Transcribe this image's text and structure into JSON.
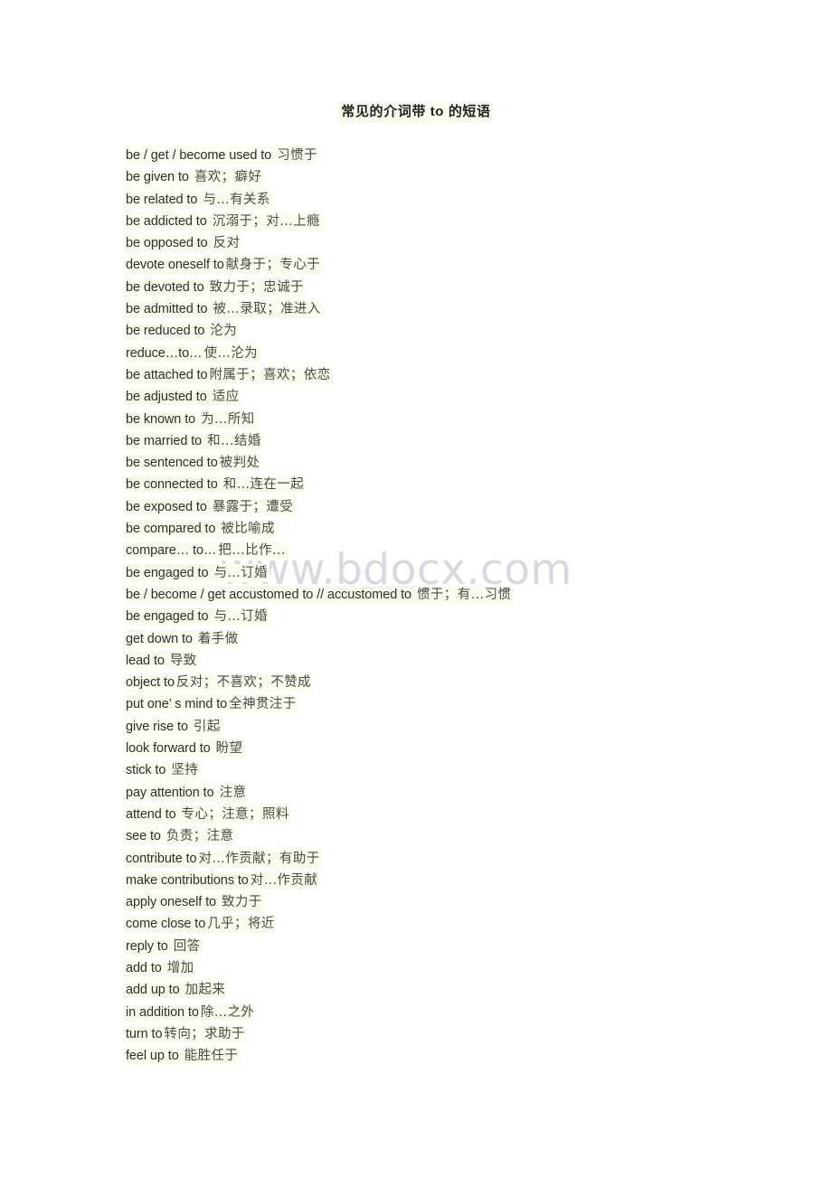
{
  "document": {
    "title": "常见的介词带 to 的短语",
    "watermark": "www.bdocx.com",
    "colors": {
      "page_background": "#ffffff",
      "text_highlight": "#fbfbee",
      "english_text": "#2e2e2e",
      "chinese_text": "#4a4a48",
      "watermark_text": "#d8d8e2"
    }
  },
  "phrases": [
    {
      "en": "be / get / become used to",
      "zh": "习惯于",
      "gap": "wide"
    },
    {
      "en": "be given to",
      "zh": "喜欢；癖好",
      "gap": "wide"
    },
    {
      "en": "be related to",
      "zh": "与…有关系",
      "gap": "wide"
    },
    {
      "en": "be addicted to",
      "zh": "沉溺于；对…上瘾",
      "gap": "wide"
    },
    {
      "en": "be opposed to",
      "zh": "反对",
      "gap": "wide"
    },
    {
      "en": "devote oneself to",
      "zh": "献身于；专心于",
      "gap": "narrow"
    },
    {
      "en": "be devoted to",
      "zh": "致力于；忠诚于",
      "gap": "wide"
    },
    {
      "en": "be admitted to",
      "zh": "被…录取；准进入",
      "gap": "wide"
    },
    {
      "en": "be reduced to",
      "zh": "沦为",
      "gap": "wide"
    },
    {
      "en": "reduce…to…",
      "zh": "使…沦为",
      "gap": "narrow"
    },
    {
      "en": "be attached to",
      "zh": "附属于；喜欢；依恋",
      "gap": "narrow"
    },
    {
      "en": "be adjusted to",
      "zh": "适应",
      "gap": "wide"
    },
    {
      "en": "be known to",
      "zh": "为…所知",
      "gap": "wide"
    },
    {
      "en": "be married to",
      "zh": "和…结婚",
      "gap": "wide"
    },
    {
      "en": "be sentenced to",
      "zh": "被判处",
      "gap": "narrow"
    },
    {
      "en": "be connected to",
      "zh": "和…连在一起",
      "gap": "wide"
    },
    {
      "en": "be exposed to",
      "zh": "暴露于；遭受",
      "gap": "wide"
    },
    {
      "en": "be compared to",
      "zh": "被比喻成",
      "gap": "wide"
    },
    {
      "en": "compare…  to…",
      "zh": "把…比作…",
      "gap": "narrow"
    },
    {
      "en": "be engaged to",
      "zh": "与…订婚",
      "gap": "wide"
    },
    {
      "en": "be / become / get accustomed to // accustomed to",
      "zh": "惯于；有…习惯",
      "gap": "wide"
    },
    {
      "en": "be engaged to",
      "zh": "与…订婚",
      "gap": "wide"
    },
    {
      "en": "get down to",
      "zh": "着手做",
      "gap": "wide"
    },
    {
      "en": "lead to",
      "zh": "导致",
      "gap": "wide"
    },
    {
      "en": "object to",
      "zh": "反对；不喜欢；不赞成",
      "gap": "narrow"
    },
    {
      "en": "put one’ s mind to",
      "zh": "全神贯注于",
      "gap": "narrow"
    },
    {
      "en": "give rise to",
      "zh": "引起",
      "gap": "wide"
    },
    {
      "en": "look forward to",
      "zh": "盼望",
      "gap": "wide"
    },
    {
      "en": "stick to",
      "zh": "坚持",
      "gap": "wide"
    },
    {
      "en": "pay attention to",
      "zh": "注意",
      "gap": "wide"
    },
    {
      "en": "attend to",
      "zh": "专心；注意；照料",
      "gap": "wide"
    },
    {
      "en": "see to",
      "zh": "负责；注意",
      "gap": "wide"
    },
    {
      "en": "contribute to",
      "zh": "对…作贡献；有助于",
      "gap": "narrow"
    },
    {
      "en": "make contributions to",
      "zh": "对…作贡献",
      "gap": "narrow"
    },
    {
      "en": "apply oneself to",
      "zh": "致力于",
      "gap": "wide"
    },
    {
      "en": "come close to",
      "zh": "几乎；将近",
      "gap": "narrow"
    },
    {
      "en": "reply to",
      "zh": "回答",
      "gap": "wide"
    },
    {
      "en": "add to",
      "zh": "增加",
      "gap": "wide"
    },
    {
      "en": "add up to",
      "zh": "加起来",
      "gap": "wide"
    },
    {
      "en": "in addition to",
      "zh": "除…之外",
      "gap": "narrow"
    },
    {
      "en": "turn to",
      "zh": "转向；求助于",
      "gap": "narrow"
    },
    {
      "en": "feel up to",
      "zh": "能胜任于",
      "gap": "wide"
    }
  ]
}
